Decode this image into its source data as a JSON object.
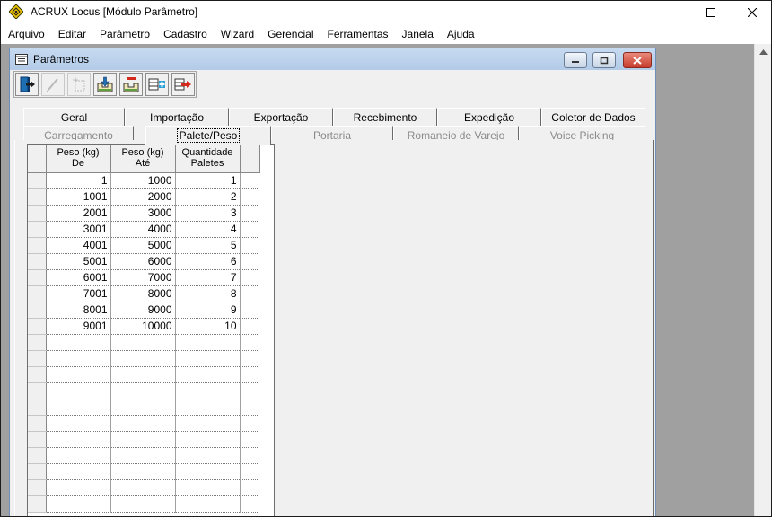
{
  "app": {
    "title": "ACRUX Locus [Módulo Parâmetro]",
    "icon": "acrux-logo-icon"
  },
  "menu": [
    "Arquivo",
    "Editar",
    "Parâmetro",
    "Cadastro",
    "Wizard",
    "Gerencial",
    "Ferramentas",
    "Janela",
    "Ajuda"
  ],
  "child_window": {
    "title": "Parâmetros"
  },
  "toolbar": {
    "buttons": [
      {
        "name": "exit-icon",
        "enabled": true
      },
      {
        "name": "edit-icon",
        "enabled": false
      },
      {
        "name": "new-record-icon",
        "enabled": false
      },
      {
        "name": "save-icon",
        "enabled": true
      },
      {
        "name": "delete-icon",
        "enabled": true
      },
      {
        "name": "insert-row-icon",
        "enabled": true
      },
      {
        "name": "remove-row-icon",
        "enabled": true
      }
    ]
  },
  "tabs": {
    "row1": [
      "Geral",
      "Importação",
      "Exportação",
      "Recebimento",
      "Expedição",
      "Coletor de Dados"
    ],
    "row2": [
      "Carregamento",
      "Palete/Peso",
      "Portaria",
      "Romaneio de Varejo",
      "Voice Picking"
    ],
    "active": "Palete/Peso"
  },
  "grid": {
    "columns": [
      "Peso (kg)\nDe",
      "Peso (kg)\nAté",
      "Quantidade\nPaletes"
    ],
    "rows": [
      [
        "1",
        "1000",
        "1"
      ],
      [
        "1001",
        "2000",
        "2"
      ],
      [
        "2001",
        "3000",
        "3"
      ],
      [
        "3001",
        "4000",
        "4"
      ],
      [
        "4001",
        "5000",
        "5"
      ],
      [
        "5001",
        "6000",
        "6"
      ],
      [
        "6001",
        "7000",
        "7"
      ],
      [
        "7001",
        "8000",
        "8"
      ],
      [
        "8001",
        "9000",
        "9"
      ],
      [
        "9001",
        "10000",
        "10"
      ]
    ]
  },
  "colors": {
    "mdi_background": "#a0a0a0",
    "child_titlebar": "#b9d1ea",
    "close_button": "#c94a3a"
  }
}
